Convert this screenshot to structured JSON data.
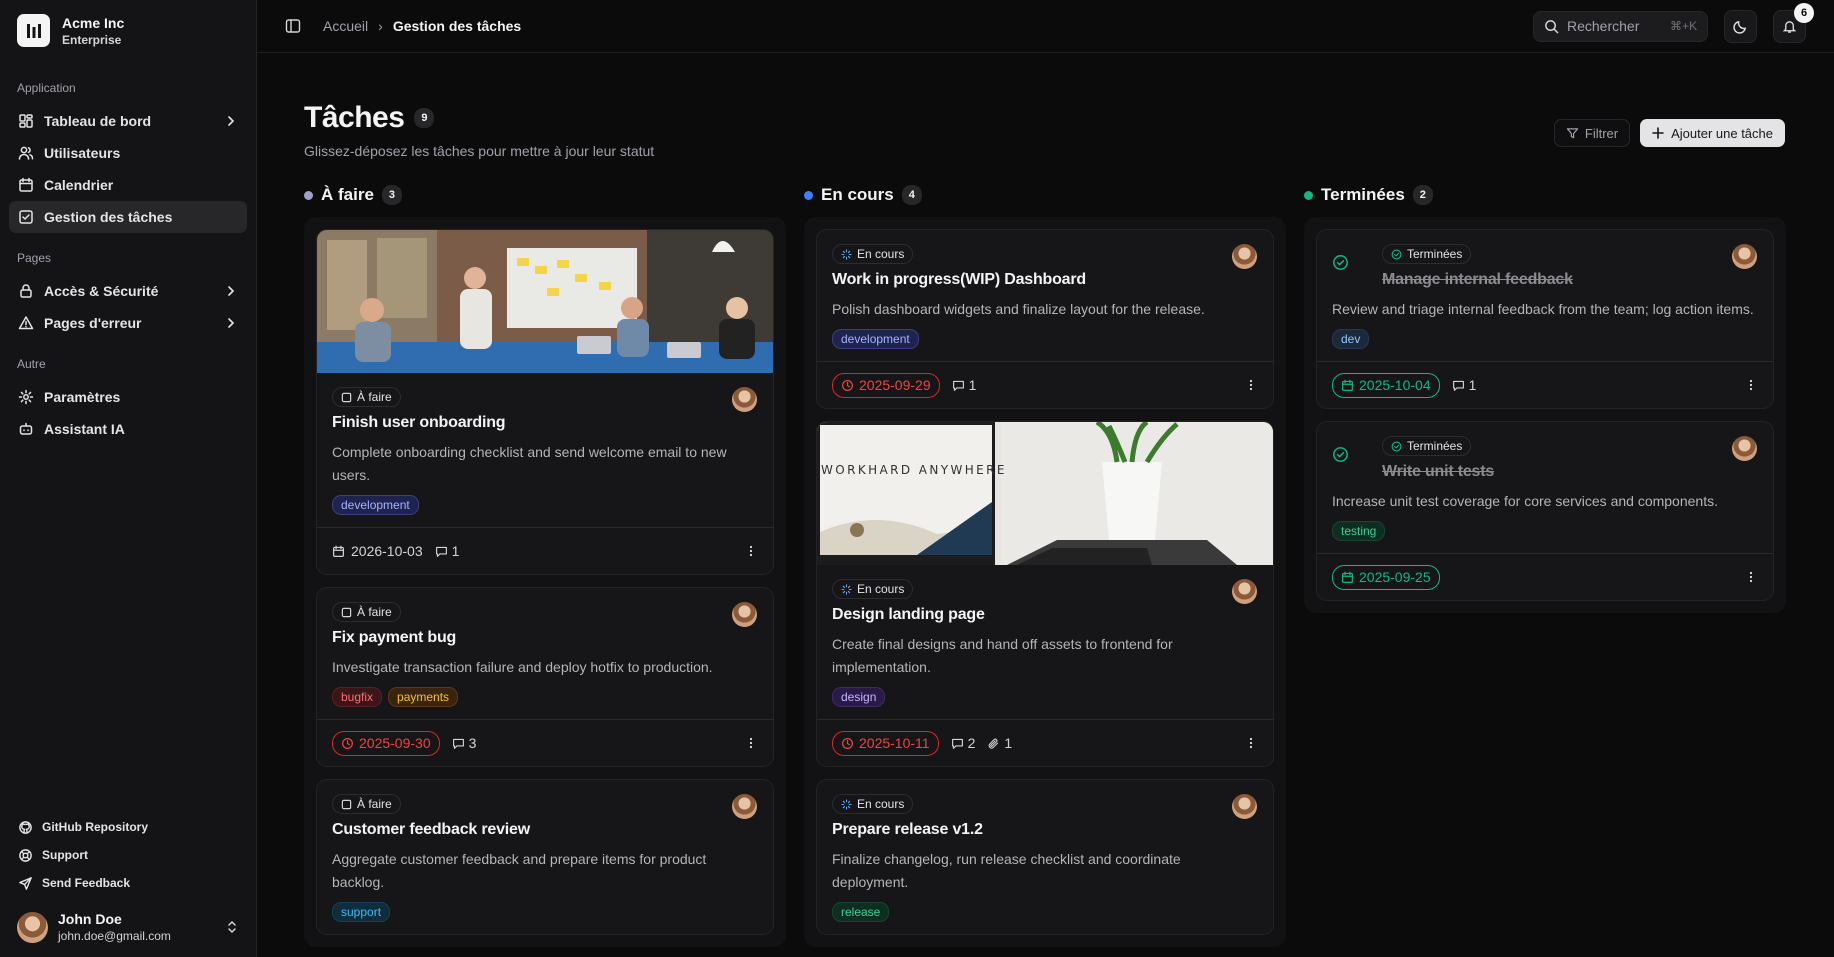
{
  "brand": {
    "name": "Acme Inc",
    "plan": "Enterprise"
  },
  "sidebar": {
    "sections": [
      {
        "label": "Application",
        "items": [
          {
            "label": "Tableau de bord",
            "icon": "dashboard-icon",
            "chevron": true
          },
          {
            "label": "Utilisateurs",
            "icon": "users-icon",
            "chevron": false
          },
          {
            "label": "Calendrier",
            "icon": "calendar-icon",
            "chevron": false
          },
          {
            "label": "Gestion des tâches",
            "icon": "tasks-icon",
            "chevron": false,
            "active": true
          }
        ]
      },
      {
        "label": "Pages",
        "items": [
          {
            "label": "Accès & Sécurité",
            "icon": "lock-icon",
            "chevron": true
          },
          {
            "label": "Pages d'erreur",
            "icon": "warning-icon",
            "chevron": true
          }
        ]
      },
      {
        "label": "Autre",
        "items": [
          {
            "label": "Paramètres",
            "icon": "gear-icon",
            "chevron": false
          },
          {
            "label": "Assistant IA",
            "icon": "bot-icon",
            "chevron": false
          }
        ]
      }
    ],
    "bottom": [
      {
        "label": "GitHub Repository",
        "icon": "github-icon"
      },
      {
        "label": "Support",
        "icon": "lifebuoy-icon"
      },
      {
        "label": "Send Feedback",
        "icon": "send-icon"
      }
    ],
    "user": {
      "name": "John Doe",
      "email": "john.doe@gmail.com"
    }
  },
  "topbar": {
    "breadcrumb": [
      "Accueil",
      "Gestion des tâches"
    ],
    "search_placeholder": "Rechercher",
    "search_shortcut": "⌘+K",
    "notifications": "6"
  },
  "page": {
    "title": "Tâches",
    "count": "9",
    "subtitle": "Glissez-déposez les tâches pour mettre à jour leur statut",
    "filter_label": "Filtrer",
    "add_label": "Ajouter une tâche"
  },
  "columns": [
    {
      "title": "À faire",
      "count": "3",
      "color": "#a1a1c7",
      "cards": [
        {
          "image": "team",
          "status": "À faire",
          "title": "Finish user onboarding",
          "desc": "Complete onboarding checklist and send welcome email to new users.",
          "tags": [
            {
              "label": "development",
              "kind": "dev-blue"
            }
          ],
          "date": "2026-10-03",
          "date_style": "plain",
          "comments": "1",
          "attachments": ""
        },
        {
          "image": "",
          "status": "À faire",
          "title": "Fix payment bug",
          "desc": "Investigate transaction failure and deploy hotfix to production.",
          "tags": [
            {
              "label": "bugfix",
              "kind": "red"
            },
            {
              "label": "payments",
              "kind": "orange"
            }
          ],
          "date": "2025-09-30",
          "date_style": "red",
          "comments": "3",
          "attachments": ""
        },
        {
          "image": "",
          "status": "À faire",
          "title": "Customer feedback review",
          "desc": "Aggregate customer feedback and prepare items for product backlog.",
          "tags": [
            {
              "label": "support",
              "kind": "cyan"
            }
          ],
          "date": "",
          "date_style": "plain",
          "comments": "",
          "attachments": ""
        }
      ]
    },
    {
      "title": "En cours",
      "count": "4",
      "color": "#3b82f6",
      "cards": [
        {
          "image": "",
          "status": "En cours",
          "title": "Work in progress(WIP) Dashboard",
          "desc": "Polish dashboard widgets and finalize layout for the release.",
          "tags": [
            {
              "label": "development",
              "kind": "dev-blue"
            }
          ],
          "date": "2025-09-29",
          "date_style": "red",
          "comments": "1",
          "attachments": ""
        },
        {
          "image": "desk",
          "status": "En cours",
          "title": "Design landing page",
          "desc": "Create final designs and hand off assets to frontend for implementation.",
          "tags": [
            {
              "label": "design",
              "kind": "purple"
            }
          ],
          "date": "2025-10-11",
          "date_style": "red",
          "comments": "2",
          "attachments": "1"
        },
        {
          "image": "",
          "status": "En cours",
          "title": "Prepare release v1.2",
          "desc": "Finalize changelog, run release checklist and coordinate deployment.",
          "tags": [
            {
              "label": "release",
              "kind": "green"
            }
          ],
          "date": "",
          "date_style": "plain",
          "comments": "",
          "attachments": ""
        }
      ]
    },
    {
      "title": "Terminées",
      "count": "2",
      "color": "#10b981",
      "cards": [
        {
          "image": "",
          "status": "Terminées",
          "title": "Manage internal feedback",
          "desc": "Review and triage internal feedback from the team; log action items.",
          "tags": [
            {
              "label": "dev",
              "kind": "slate"
            }
          ],
          "date": "2025-10-04",
          "date_style": "green",
          "comments": "1",
          "attachments": "",
          "done": true
        },
        {
          "image": "",
          "status": "Terminées",
          "title": "Write unit tests",
          "desc": "Increase unit test coverage for core services and components.",
          "tags": [
            {
              "label": "testing",
              "kind": "green"
            }
          ],
          "date": "2025-09-25",
          "date_style": "green",
          "comments": "",
          "attachments": "",
          "done": true
        }
      ]
    }
  ],
  "desk_image_text": "WORKHARD ANYWHERE"
}
